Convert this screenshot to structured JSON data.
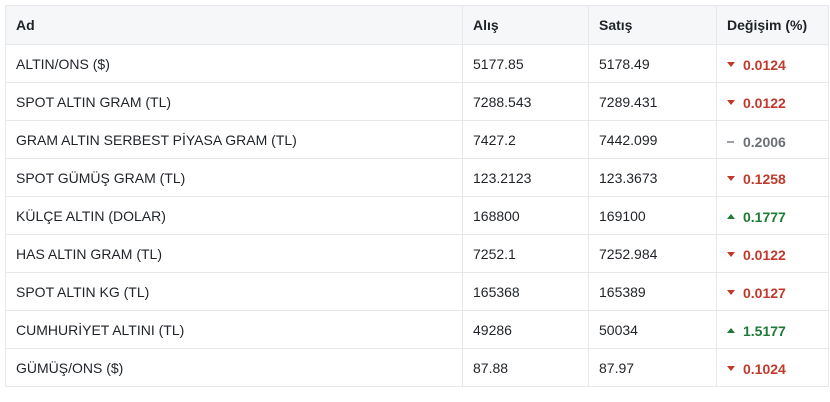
{
  "table": {
    "headers": {
      "name": "Ad",
      "buy": "Alış",
      "sell": "Satış",
      "change": "Değişim (%)"
    },
    "rows": [
      {
        "name": "ALTIN/ONS ($)",
        "buy": "5177.85",
        "sell": "5178.49",
        "change": "0.0124",
        "direction": "down",
        "direction_icon": "caret-down-icon"
      },
      {
        "name": "SPOT ALTIN GRAM (TL)",
        "buy": "7288.543",
        "sell": "7289.431",
        "change": "0.0122",
        "direction": "down",
        "direction_icon": "caret-down-icon"
      },
      {
        "name": "GRAM ALTIN SERBEST PİYASA GRAM (TL)",
        "buy": "7427.2",
        "sell": "7442.099",
        "change": "0.2006",
        "direction": "flat",
        "direction_icon": "dash-icon"
      },
      {
        "name": "SPOT GÜMÜŞ GRAM (TL)",
        "buy": "123.2123",
        "sell": "123.3673",
        "change": "0.1258",
        "direction": "down",
        "direction_icon": "caret-down-icon"
      },
      {
        "name": "KÜLÇE ALTIN (DOLAR)",
        "buy": "168800",
        "sell": "169100",
        "change": "0.1777",
        "direction": "up",
        "direction_icon": "caret-up-icon"
      },
      {
        "name": "HAS ALTIN GRAM (TL)",
        "buy": "7252.1",
        "sell": "7252.984",
        "change": "0.0122",
        "direction": "down",
        "direction_icon": "caret-down-icon"
      },
      {
        "name": "SPOT ALTIN KG (TL)",
        "buy": "165368",
        "sell": "165389",
        "change": "0.0127",
        "direction": "down",
        "direction_icon": "caret-down-icon"
      },
      {
        "name": "CUMHURİYET ALTINI (TL)",
        "buy": "49286",
        "sell": "50034",
        "change": "1.5177",
        "direction": "up",
        "direction_icon": "caret-up-icon"
      },
      {
        "name": "GÜMÜŞ/ONS ($)",
        "buy": "87.88",
        "sell": "87.97",
        "change": "0.1024",
        "direction": "down",
        "direction_icon": "caret-down-icon"
      }
    ]
  },
  "colors": {
    "down": "#c0392b",
    "up": "#1e7a34",
    "flat": "#6b6f75",
    "header_bg": "#f6f7f9",
    "border": "#e6e8eb"
  }
}
